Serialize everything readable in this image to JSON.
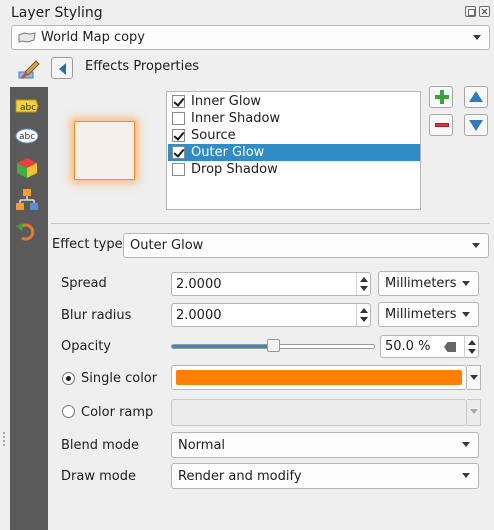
{
  "panel": {
    "title": "Layer Styling"
  },
  "layer_combo": {
    "value": "World Map copy"
  },
  "header": {
    "title": "Effects Properties"
  },
  "effects": [
    {
      "label": "Inner Glow",
      "checked": true,
      "selected": false
    },
    {
      "label": "Inner Shadow",
      "checked": false,
      "selected": false
    },
    {
      "label": "Source",
      "checked": true,
      "selected": false
    },
    {
      "label": "Outer Glow",
      "checked": true,
      "selected": true
    },
    {
      "label": "Drop Shadow",
      "checked": false,
      "selected": false
    }
  ],
  "form": {
    "effect_type_label": "Effect type",
    "effect_type_value": "Outer Glow",
    "spread_label": "Spread",
    "spread_value": "2.0000",
    "spread_unit": "Millimeters",
    "blur_label": "Blur radius",
    "blur_value": "2.0000",
    "blur_unit": "Millimeters",
    "opacity_label": "Opacity",
    "opacity_value": "50.0 %",
    "opacity_fraction": 0.5,
    "single_color_label": "Single color",
    "single_color_checked": true,
    "single_color_hex": "#ff8000",
    "color_ramp_label": "Color ramp",
    "color_ramp_checked": false,
    "blend_mode_label": "Blend mode",
    "blend_mode_value": "Normal",
    "draw_mode_label": "Draw mode",
    "draw_mode_value": "Render and modify"
  },
  "colors": {
    "selection": "#308cc6",
    "glow": "#ff8c1a",
    "sidebar": "#5a5a5a"
  },
  "icons": {
    "sidebar": [
      "label-icon",
      "label-abc-icon",
      "3d-cube-icon",
      "diagram-icon",
      "history-undo-icon"
    ],
    "top": "paint-brush-icon",
    "back": "back-arrow-icon"
  }
}
